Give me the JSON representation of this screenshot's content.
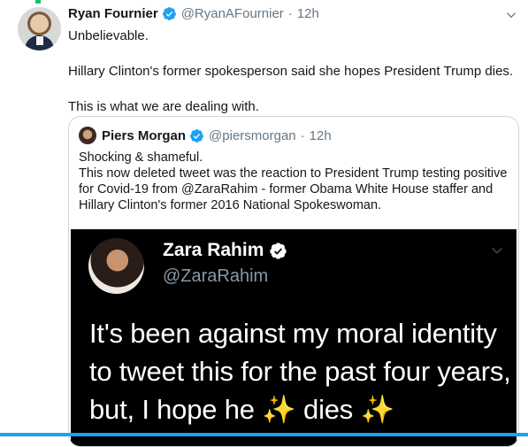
{
  "tweet": {
    "author_name": "Ryan Fournier",
    "handle": "@RyanAFournier",
    "separator": "·",
    "time": "12h",
    "paragraphs": [
      "Unbelievable.",
      "Hillary Clinton's former spokesperson said she hopes President Trump dies.",
      "This is what we are dealing with."
    ]
  },
  "quoted": {
    "author_name": "Piers Morgan",
    "handle": "@piersmorgan",
    "separator": "·",
    "time": "12h",
    "line1": "Shocking & shameful.",
    "line2": "This now deleted tweet was the reaction to President Trump testing positive for Covid-19 from @ZaraRahim - former Obama White House staffer and Hillary Clinton's former 2016 National Spokeswoman."
  },
  "image_tweet": {
    "author_name": "Zara Rahim",
    "handle": "@ZaraRahim",
    "text_part1": "It's been against my moral identity to tweet this for the past four years, but, I hope he ",
    "sparkle1": "✨",
    "text_part2": " dies ",
    "sparkle2": "✨"
  },
  "colors": {
    "verified": "#1da1f2",
    "accent": "#1da1f2",
    "secondary_text": "#657786"
  },
  "icons": [
    "verified-badge-icon",
    "chevron-down-icon"
  ]
}
